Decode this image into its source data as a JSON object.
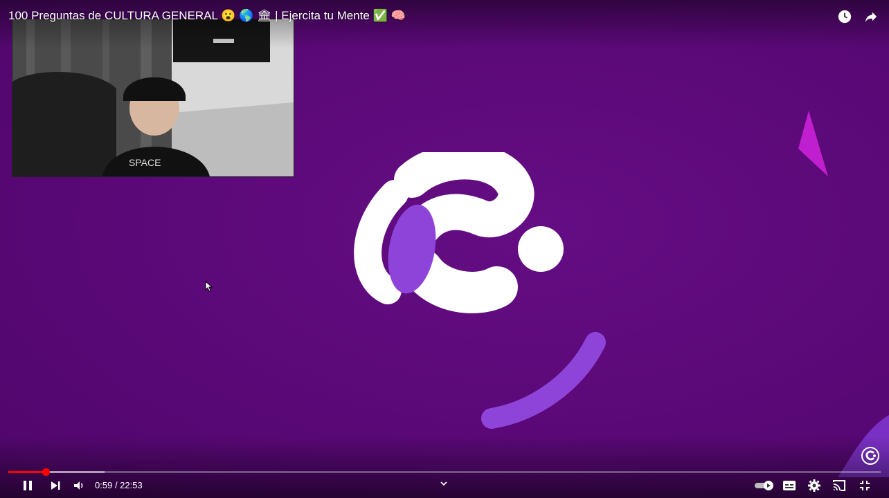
{
  "video": {
    "title": "100 Preguntas de CULTURA GENERAL 😮 🌎 🏛 | Ejercita tu Mente ✅ 🧠",
    "current_time": "0:59",
    "duration": "22:53",
    "progress_fraction": 0.0431,
    "buffered_fraction": 0.11
  },
  "top_icons": [
    "watch-later-icon",
    "share-icon"
  ],
  "controls": {
    "left": [
      "pause-icon",
      "next-icon",
      "volume-icon"
    ],
    "right": [
      "autoplay-toggle-icon",
      "subtitles-icon",
      "settings-icon",
      "cast-icon",
      "exit-fullscreen-icon"
    ]
  },
  "colors": {
    "background": "#5c0a78",
    "accent_purple": "#8e44d9",
    "progress": "#ff0000"
  }
}
